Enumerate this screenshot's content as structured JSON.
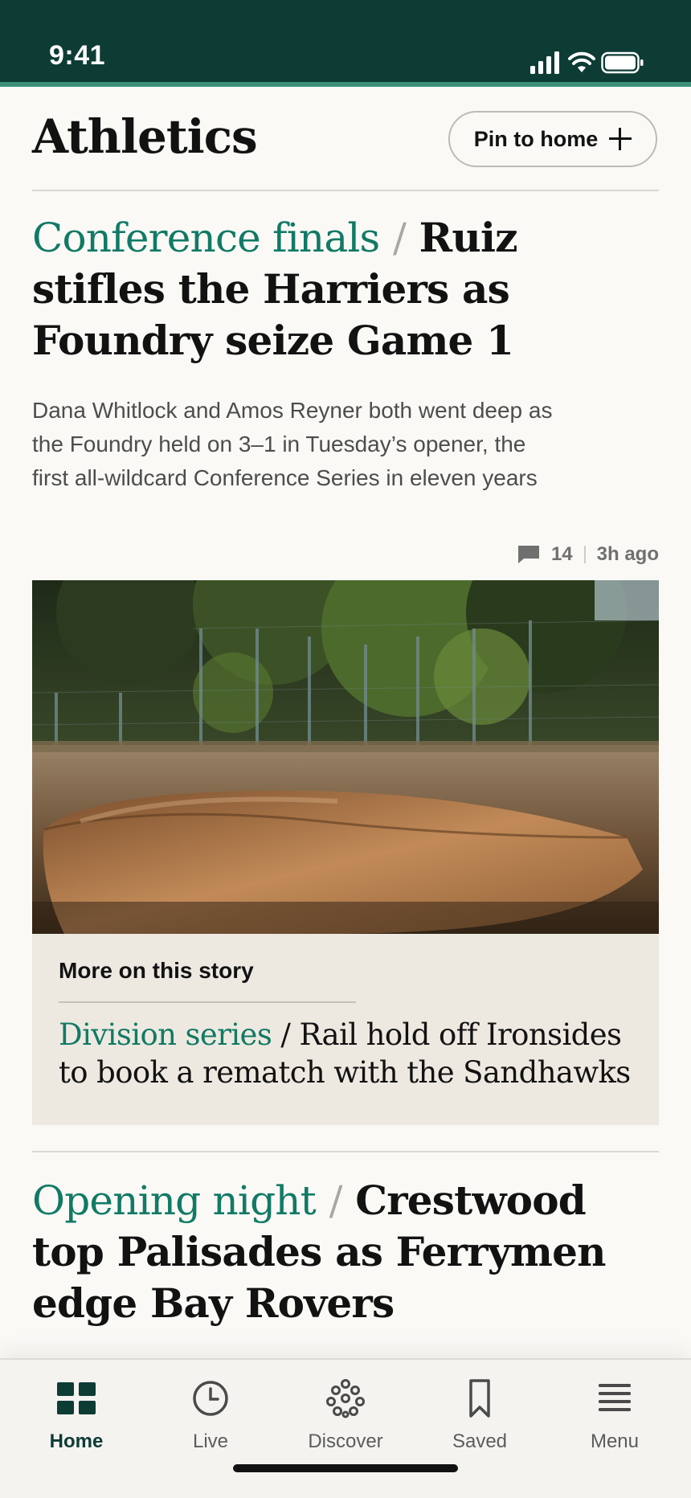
{
  "status_bar": {
    "time": "9:41"
  },
  "header": {
    "title": "Athletics",
    "pin_button_label": "Pin to home"
  },
  "lead_story": {
    "kicker": "Conference finals",
    "separator": "/",
    "headline": "Ruiz stifles the Harriers as Foundry seize Game 1",
    "standfirst": "Dana Whitlock and Amos Reyner both went deep as the Foundry held on 3–1 in Tuesday’s opener, the first all-wildcard Conference Series in eleven years",
    "comment_count": "14",
    "timestamp": "3h ago"
  },
  "more_on_story": {
    "title": "More on this story",
    "kicker": "Division series",
    "separator": "/",
    "headline": "Rail hold off Ironsides to book a rematch with the Sandhawks"
  },
  "second_story": {
    "kicker": "Opening night",
    "separator": "/",
    "headline": "Crestwood top Palisades as Ferrymen edge Bay Rovers"
  },
  "tab_bar": {
    "items": [
      {
        "label": "Home",
        "icon": "grid-icon",
        "active": true
      },
      {
        "label": "Live",
        "icon": "clock-icon",
        "active": false
      },
      {
        "label": "Discover",
        "icon": "dots-flower-icon",
        "active": false
      },
      {
        "label": "Saved",
        "icon": "bookmark-icon",
        "active": false
      },
      {
        "label": "Menu",
        "icon": "hamburger-icon",
        "active": false
      }
    ]
  },
  "colors": {
    "brand_dark": "#0d3c35",
    "accent": "#117a65",
    "status_bar_stripe": "#3d8f77",
    "background": "#faf9f6"
  }
}
